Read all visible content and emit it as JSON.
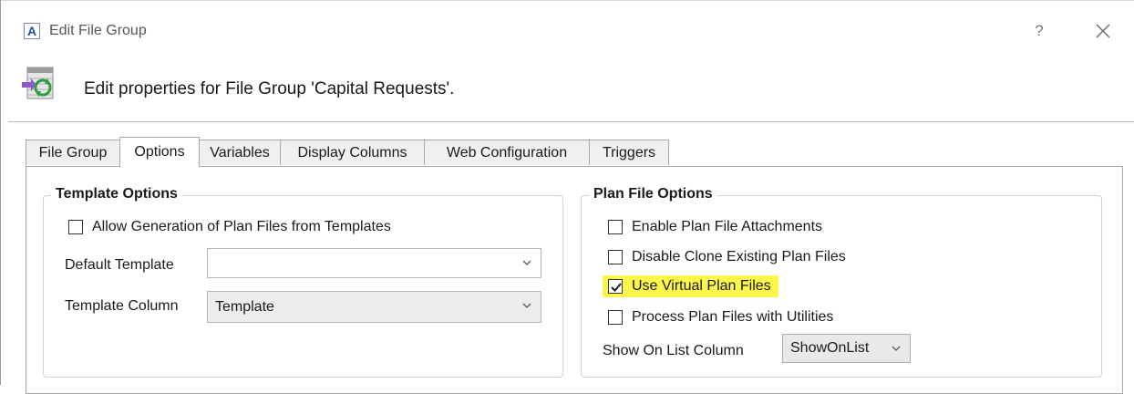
{
  "window": {
    "title": "Edit File Group",
    "app_icon_letter": "A",
    "help_label": "?",
    "close_icon": "close-icon"
  },
  "header": {
    "text": "Edit properties for File Group 'Capital Requests'.",
    "icon": "file-group-sync-icon"
  },
  "tabs": [
    {
      "label": "File Group",
      "active": false
    },
    {
      "label": "Options",
      "active": true
    },
    {
      "label": "Variables",
      "active": false
    },
    {
      "label": "Display Columns",
      "active": false
    },
    {
      "label": "Web Configuration",
      "active": false
    },
    {
      "label": "Triggers",
      "active": false
    }
  ],
  "template_options": {
    "legend": "Template Options",
    "allow_generation": {
      "label": "Allow Generation of Plan Files from Templates",
      "checked": false
    },
    "default_template": {
      "label": "Default Template",
      "value": ""
    },
    "template_column": {
      "label": "Template Column",
      "value": "Template"
    }
  },
  "plan_file_options": {
    "legend": "Plan File Options",
    "enable_attachments": {
      "label": "Enable Plan File Attachments",
      "checked": false
    },
    "disable_clone": {
      "label": "Disable Clone Existing Plan Files",
      "checked": false
    },
    "use_virtual": {
      "label": "Use Virtual Plan Files",
      "checked": true
    },
    "process_utilities": {
      "label": "Process Plan Files with Utilities",
      "checked": false
    },
    "show_on_list": {
      "label": "Show On List Column",
      "value": "ShowOnList"
    }
  },
  "colors": {
    "highlight": "#fbf64a",
    "accent": "#1f4ea8"
  }
}
